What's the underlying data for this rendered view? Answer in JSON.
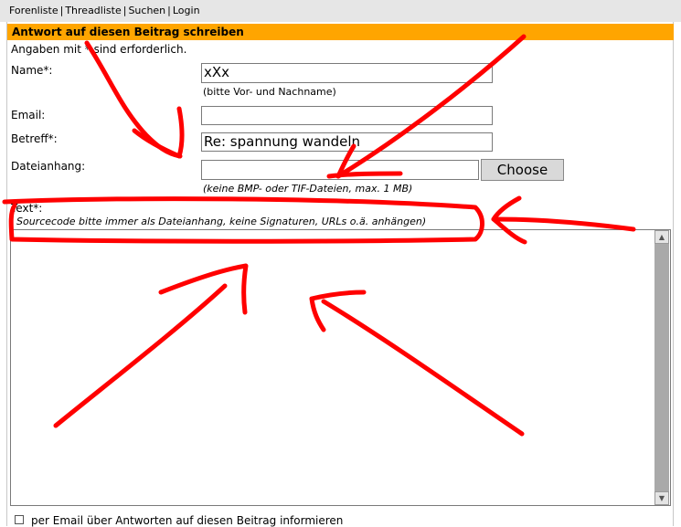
{
  "nav": {
    "items": [
      "Forenliste",
      "Threadliste",
      "Suchen",
      "Login"
    ],
    "separator": "|"
  },
  "form": {
    "header": "Antwort auf diesen Beitrag schreiben",
    "required_note": "Angaben mit * sind erforderlich.",
    "name_label": "Name*:",
    "name_value": "xXx",
    "name_hint": "(bitte Vor- und Nachname)",
    "email_label": "Email:",
    "email_value": "",
    "subject_label": "Betreff*:",
    "subject_value": "Re: spannung wandeln",
    "attachment_label": "Dateianhang:",
    "choose_label": "Choose",
    "attachment_hint": "(keine BMP- oder TIF-Dateien, max. 1 MB)",
    "text_label": "Text*:",
    "text_hint": "Sourcecode bitte immer als Dateianhang, keine Signaturen, URLs o.ä. anhängen)",
    "text_value": "",
    "notify_label": "per Email über Antworten auf diesen Beitrag informieren"
  },
  "colors": {
    "header_bg": "#ffa500",
    "annotation": "#ff0000",
    "nav_bg": "#e6e6e6"
  }
}
